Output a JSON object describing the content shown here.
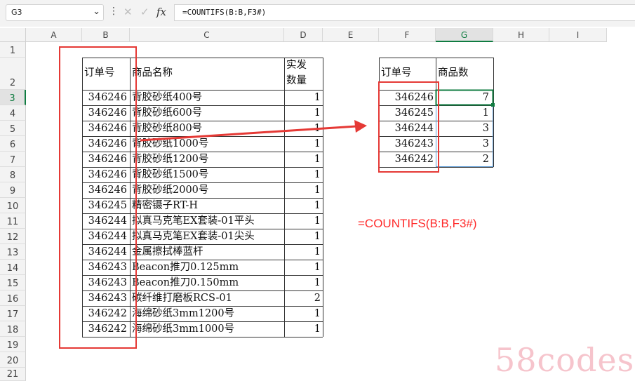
{
  "formula_bar": {
    "name_box": "G3",
    "cancel_icon": "✕",
    "enter_icon": "✓",
    "fx_label": "fx",
    "formula": "=COUNTIFS(B:B,F3#)"
  },
  "columns": [
    "A",
    "B",
    "C",
    "D",
    "E",
    "F",
    "G",
    "H",
    "I"
  ],
  "rows": [
    "1",
    "2",
    "3",
    "4",
    "5",
    "6",
    "7",
    "8",
    "9",
    "10",
    "11",
    "12",
    "13",
    "14",
    "15",
    "16",
    "17",
    "18",
    "19",
    "20",
    "21"
  ],
  "selected_cell": "G3",
  "orders_table": {
    "headers": [
      "订单号",
      "商品名称",
      "实发",
      "数量"
    ],
    "rows": [
      {
        "order": "346246",
        "name": "背胶砂纸400号",
        "qty": "1"
      },
      {
        "order": "346246",
        "name": "背胶砂纸600号",
        "qty": "1"
      },
      {
        "order": "346246",
        "name": "背胶砂纸800号",
        "qty": "1"
      },
      {
        "order": "346246",
        "name": "背胶砂纸1000号",
        "qty": "1"
      },
      {
        "order": "346246",
        "name": "背胶砂纸1200号",
        "qty": "1"
      },
      {
        "order": "346246",
        "name": "背胶砂纸1500号",
        "qty": "1"
      },
      {
        "order": "346246",
        "name": "背胶砂纸2000号",
        "qty": "1"
      },
      {
        "order": "346245",
        "name": "精密镊子RT-H",
        "qty": "1"
      },
      {
        "order": "346244",
        "name": "拟真马克笔EX套装-01平头",
        "qty": "1"
      },
      {
        "order": "346244",
        "name": "拟真马克笔EX套装-01尖头",
        "qty": "1"
      },
      {
        "order": "346244",
        "name": "金属擦拭棒蓝杆",
        "qty": "1"
      },
      {
        "order": "346243",
        "name": "Beacon推刀0.125mm",
        "qty": "1"
      },
      {
        "order": "346243",
        "name": "Beacon推刀0.150mm",
        "qty": "1"
      },
      {
        "order": "346243",
        "name": "碳纤维打磨板RCS-01",
        "qty": "2"
      },
      {
        "order": "346242",
        "name": "海绵砂纸3mm1200号",
        "qty": "1"
      },
      {
        "order": "346242",
        "name": "海绵砂纸3mm1000号",
        "qty": "1"
      }
    ]
  },
  "summary_table": {
    "headers": [
      "订单号",
      "商品数"
    ],
    "rows": [
      {
        "order": "346246",
        "count": "7"
      },
      {
        "order": "346245",
        "count": "1"
      },
      {
        "order": "346244",
        "count": "3"
      },
      {
        "order": "346243",
        "count": "3"
      },
      {
        "order": "346242",
        "count": "2"
      }
    ]
  },
  "annotation": "=COUNTIFS(B:B,F3#)",
  "watermark": "58codes",
  "colors": {
    "highlight": "#e53935",
    "accent": "#107c41",
    "annotation": "#ff2a2a"
  }
}
